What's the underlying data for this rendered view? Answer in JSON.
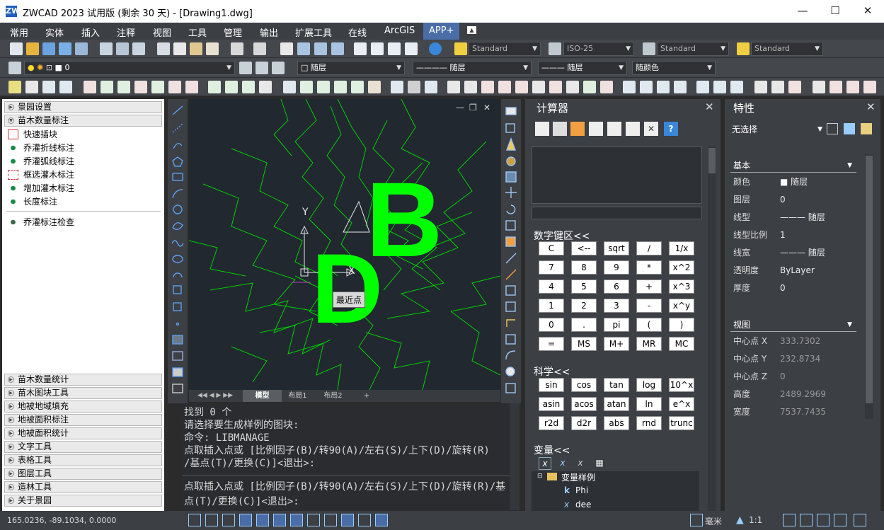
{
  "window": {
    "title": "ZWCAD 2023 试用版 (剩余 30 天) - [Drawing1.dwg]",
    "app_icon": "ZW",
    "minimize": "—",
    "maximize": "☐",
    "close": "✕"
  },
  "menu": [
    "常用",
    "实体",
    "插入",
    "注释",
    "视图",
    "工具",
    "管理",
    "输出",
    "扩展工具",
    "在线",
    "ArcGIS",
    "APP+"
  ],
  "toolbar": {
    "text_style": "Standard",
    "dim_style": "ISO-25",
    "table_style": "Standard",
    "multileader_style": "Standard",
    "layer": "0",
    "color": "随层",
    "linetype": "随层",
    "lineweight": "随层",
    "plot_style": "随颜色"
  },
  "left_panel": {
    "top_groups": [
      "景园设置",
      "苗木数量标注"
    ],
    "tools": [
      "快速插块",
      "乔灌折线标注",
      "乔灌弧线标注",
      "框选灌木标注",
      "增加灌木标注",
      "长度标注"
    ],
    "extra_tool": "乔灌标注检查",
    "bottom_groups": [
      "苗木数量统计",
      "苗木图块工具",
      "地被地域填充",
      "地被面积标注",
      "地被面积统计",
      "文字工具",
      "表格工具",
      "图层工具",
      "造林工具",
      "关于景园"
    ]
  },
  "drawing": {
    "letter_big": "B",
    "letter_small": "D",
    "tooltip": "最近点",
    "axis_y": "Y",
    "axis_x": "X",
    "accent": "#00ff00"
  },
  "layout_tabs": [
    "模型",
    "布局1",
    "布局2",
    "+"
  ],
  "command_lines": [
    "找到 0 个",
    "  请选择要生成样例的图块:",
    "命令: LIBMANAGE",
    "点取插入点或 [比例因子(B)/转90(A)/左右(S)/上下(D)/旋转(R)",
    "/基点(T)/更换(C)]<退出>:",
    "点取插入点或 [比例因子(B)/转90(A)/左右(S)/上下(D)/旋转(R)/基",
    "点(T)/更换(C)]<退出>:"
  ],
  "status": {
    "coords": "165.0236,  -89.1034,  0.0000",
    "units": "毫米",
    "scale": "1:1"
  },
  "calculator": {
    "title": "计算器",
    "numpad_title": "数字键区<<",
    "numpad": [
      [
        "C",
        "<--",
        "sqrt",
        "/",
        "1/x"
      ],
      [
        "7",
        "8",
        "9",
        "*",
        "x^2"
      ],
      [
        "4",
        "5",
        "6",
        "+",
        "x^3"
      ],
      [
        "1",
        "2",
        "3",
        "-",
        "x^y"
      ],
      [
        "0",
        ".",
        "pi",
        "(",
        ")"
      ],
      [
        "=",
        "MS",
        "M+",
        "MR",
        "MC"
      ]
    ],
    "sci_title": "科学<<",
    "sci": [
      [
        "sin",
        "cos",
        "tan",
        "log",
        "10^x"
      ],
      [
        "asin",
        "acos",
        "atan",
        "ln",
        "e^x"
      ],
      [
        "r2d",
        "d2r",
        "abs",
        "rnd",
        "trunc"
      ]
    ],
    "vars_title": "变量<<",
    "var_tree": {
      "folder": "变量样例",
      "items": [
        {
          "icon": "k",
          "name": "Phi"
        },
        {
          "icon": "x",
          "name": "dee"
        }
      ]
    }
  },
  "properties": {
    "title": "特性",
    "selection": "无选择",
    "basic_header": "基本",
    "basic": [
      {
        "label": "颜色",
        "value": "随层"
      },
      {
        "label": "图层",
        "value": "0"
      },
      {
        "label": "线型",
        "value": "——— 随层"
      },
      {
        "label": "线型比例",
        "value": "1"
      },
      {
        "label": "线宽",
        "value": "——— 随层"
      },
      {
        "label": "透明度",
        "value": "ByLayer"
      },
      {
        "label": "厚度",
        "value": "0"
      }
    ],
    "view_header": "视图",
    "view": [
      {
        "label": "中心点 X",
        "value": "333.7302"
      },
      {
        "label": "中心点 Y",
        "value": "232.8734"
      },
      {
        "label": "中心点 Z",
        "value": "0"
      },
      {
        "label": "高度",
        "value": "2489.2969"
      },
      {
        "label": "宽度",
        "value": "7537.7435"
      }
    ]
  }
}
